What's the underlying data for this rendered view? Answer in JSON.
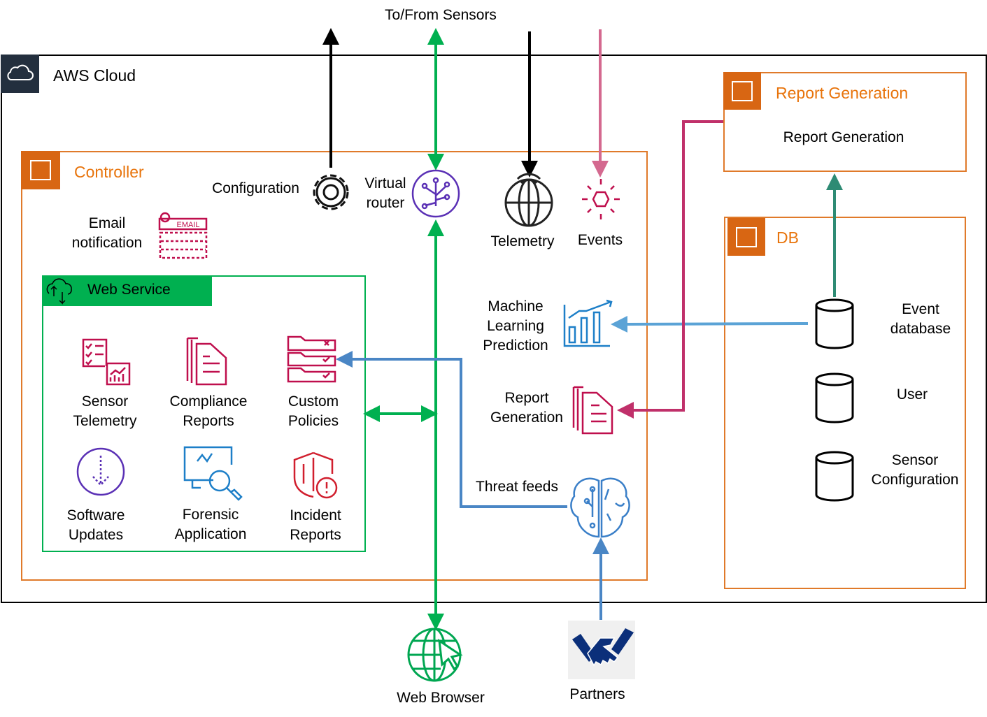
{
  "top_label": "To/From Sensors",
  "cloud": {
    "title": "AWS Cloud",
    "icon": "cloud-icon"
  },
  "controller": {
    "title": "Controller",
    "configuration": "Configuration",
    "virtual_router": [
      "Virtual",
      "router"
    ],
    "telemetry": "Telemetry",
    "events": "Events",
    "email_notification": [
      "Email",
      "notification"
    ],
    "email_badge": "EMAIL",
    "ml_prediction": [
      "Machine",
      "Learning",
      "Prediction"
    ],
    "report_generation": [
      "Report",
      "Generation"
    ],
    "threat_feeds": "Threat feeds"
  },
  "web_service": {
    "title": "Web Service",
    "items": [
      {
        "label": [
          "Sensor",
          "Telemetry"
        ]
      },
      {
        "label": [
          "Compliance",
          "Reports"
        ]
      },
      {
        "label": [
          "Custom",
          "Policies"
        ]
      },
      {
        "label": [
          "Software",
          "Updates"
        ]
      },
      {
        "label": [
          "Forensic",
          "Application"
        ]
      },
      {
        "label": [
          "Incident",
          "Reports"
        ]
      }
    ]
  },
  "report_generation_box": {
    "title": "Report Generation",
    "content": "Report Generation"
  },
  "db": {
    "title": "DB",
    "items": [
      {
        "label": [
          "Event",
          "database"
        ]
      },
      {
        "label": [
          "User"
        ]
      },
      {
        "label": [
          "Sensor",
          "Configuration"
        ]
      }
    ]
  },
  "web_browser": "Web Browser",
  "partners": "Partners",
  "colors": {
    "aws_orange": "#d86613",
    "web_service_green": "#00b050",
    "flow_green": "#00b050",
    "threat_blue": "#4a86c5",
    "ml_blue": "#5ba3d6",
    "report_magenta": "#c0306a",
    "events_pink": "#d4698f",
    "db_teal": "#2e8b74",
    "icon_crimson": "#bf0f4d",
    "icon_purple": "#5a30b5"
  }
}
